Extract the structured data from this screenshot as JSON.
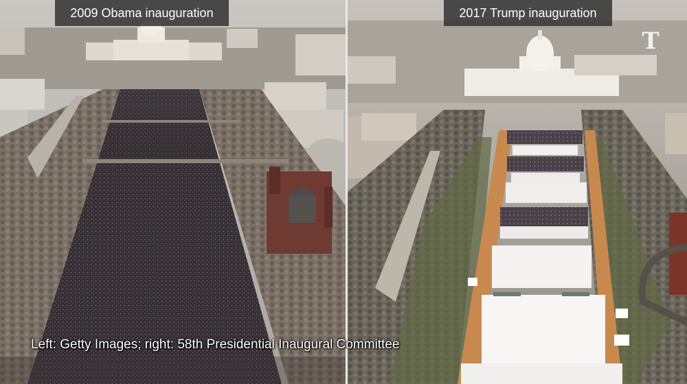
{
  "left_panel": {
    "title": "2009 Obama inauguration"
  },
  "right_panel": {
    "title": "2017 Trump inauguration"
  },
  "credit": "Left: Getty Images; right: 58th Presidential Inaugural Committee",
  "logo": {
    "text": "T",
    "icon": "nyt-logo-icon"
  }
}
